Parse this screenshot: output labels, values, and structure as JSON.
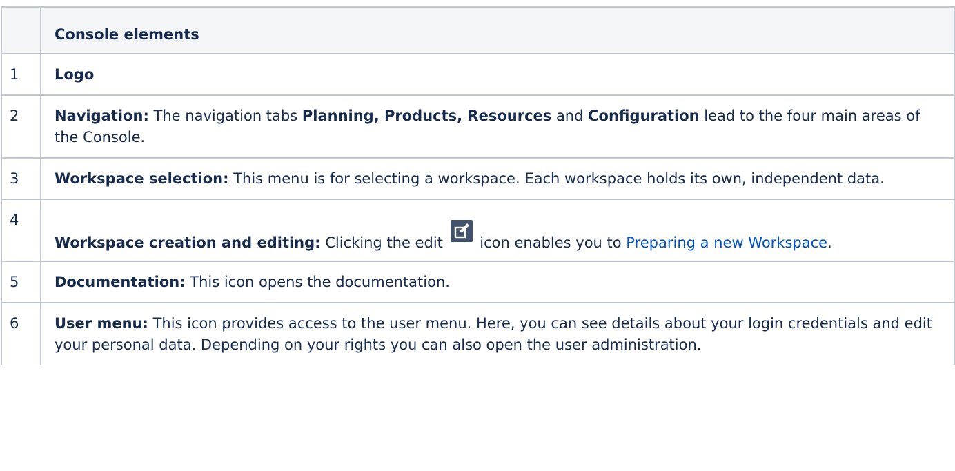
{
  "table": {
    "header": "Console elements",
    "rows": [
      {
        "num": "1",
        "title": "Logo",
        "text": ""
      },
      {
        "num": "2",
        "title": "Navigation:",
        "t1": " The navigation tabs ",
        "b1": "Planning, Products, Resources",
        "t2": " and ",
        "b2": "Configuration",
        "t3": " lead to the four main areas of the Console."
      },
      {
        "num": "3",
        "title": "Workspace selection:",
        "text": " This menu is for selecting a workspace. Each workspace holds its own, independent data."
      },
      {
        "num": "4",
        "title": "Workspace creation and editing:",
        "t1": " Clicking the edit ",
        "icon": "edit-icon",
        "t2": " icon enables you to ",
        "link": "Preparing a new Workspace",
        "t3": "."
      },
      {
        "num": "5",
        "title": "Documentation:",
        "text": " This icon opens the documentation."
      },
      {
        "num": "6",
        "title": "User menu:",
        "text": " This icon provides access to the user menu. Here, you can see details about your login credentials and edit your personal data. Depending on your rights you can also open the user administration."
      }
    ]
  },
  "colors": {
    "border": "#c1c7d0",
    "header_bg": "#f4f5f7",
    "text": "#172b4d",
    "link": "#0052cc",
    "icon_bg": "#42526e"
  }
}
